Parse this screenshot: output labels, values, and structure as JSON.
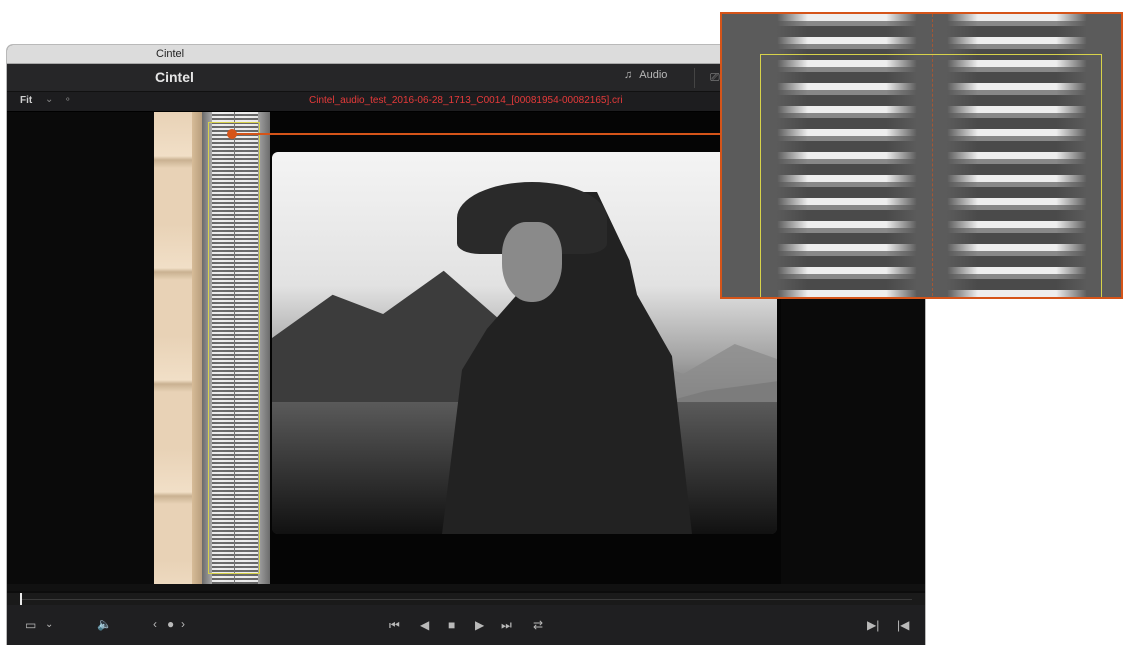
{
  "window": {
    "title": "Cintel"
  },
  "header": {
    "app_name": "Cintel",
    "audio_label": "Audio"
  },
  "viewer": {
    "zoom_label": "Fit",
    "filename": "Cintel_audio_test_2016-06-28_1713_C0014_[00081954-00082165].cri"
  },
  "playback": {
    "progress_fraction": 0.005,
    "controls": [
      "loop-icon",
      "jump-to-start-icon",
      "step-back-icon",
      "stop-icon",
      "play-icon",
      "jump-to-end-icon"
    ]
  },
  "colors": {
    "accent": "#d55419",
    "filename": "#e63a3a",
    "selection": "#d7d24a"
  }
}
